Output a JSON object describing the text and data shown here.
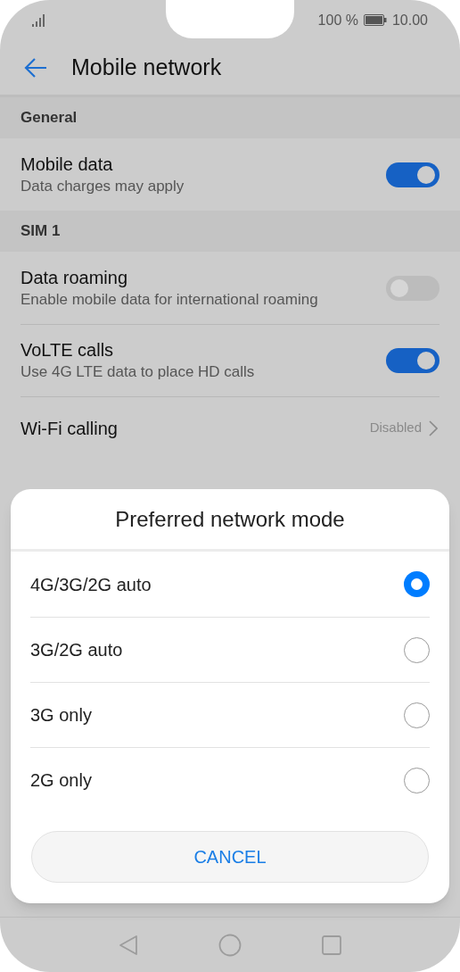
{
  "status_bar": {
    "battery": "100 %",
    "time": "10.00"
  },
  "header": {
    "title": "Mobile network"
  },
  "sections": [
    {
      "title": "General",
      "items": [
        {
          "kind": "toggle",
          "title": "Mobile data",
          "subtitle": "Data charges may apply",
          "on": true
        }
      ]
    },
    {
      "title": "SIM 1",
      "items": [
        {
          "kind": "toggle",
          "title": "Data roaming",
          "subtitle": "Enable mobile data for international roaming",
          "on": false
        },
        {
          "kind": "toggle",
          "title": "VoLTE calls",
          "subtitle": "Use 4G LTE data to place HD calls",
          "on": true
        },
        {
          "kind": "link",
          "title": "Wi-Fi calling",
          "value": "Disabled"
        }
      ]
    }
  ],
  "dialog": {
    "title": "Preferred network mode",
    "options": [
      {
        "label": "4G/3G/2G auto",
        "selected": true
      },
      {
        "label": "3G/2G auto",
        "selected": false
      },
      {
        "label": "3G only",
        "selected": false
      },
      {
        "label": "2G only",
        "selected": false
      }
    ],
    "cancel": "CANCEL"
  }
}
